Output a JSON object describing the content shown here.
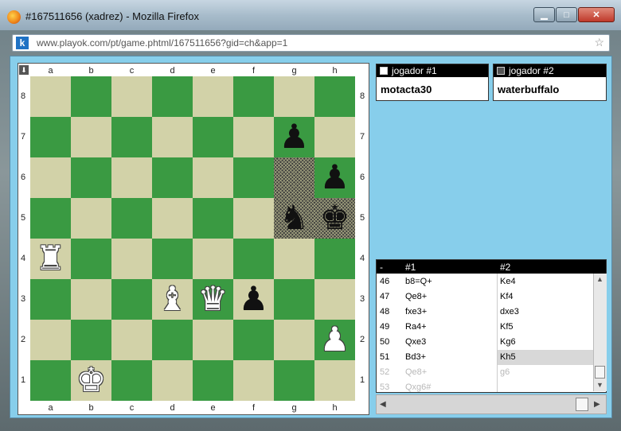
{
  "window": {
    "title": "#167511656 (xadrez) - Mozilla Firefox",
    "min": "▁",
    "max": "□",
    "close": "✕"
  },
  "browser": {
    "site_icon_letter": "k",
    "url": "www.playok.com/pt/game.phtml/167511656?gid=ch&app=1",
    "icons": [
      "firefox-icon",
      "site-icon",
      "star-icon"
    ]
  },
  "board": {
    "corner_btn": "⬇",
    "files": [
      "a",
      "b",
      "c",
      "d",
      "e",
      "f",
      "g",
      "h"
    ],
    "ranks": [
      "8",
      "7",
      "6",
      "5",
      "4",
      "3",
      "2",
      "1"
    ],
    "light_color": "#d2d2a8",
    "dark_color": "#3a9a42",
    "highlight_squares": [
      "g6",
      "g5",
      "h5"
    ],
    "pieces": [
      {
        "square": "g7",
        "color": "black",
        "glyph": "♟",
        "name": "black-pawn"
      },
      {
        "square": "h6",
        "color": "black",
        "glyph": "♟",
        "name": "black-pawn"
      },
      {
        "square": "g5",
        "color": "black",
        "glyph": "♞",
        "name": "black-knight"
      },
      {
        "square": "h5",
        "color": "black",
        "glyph": "♚",
        "name": "black-king"
      },
      {
        "square": "a4",
        "color": "white",
        "glyph": "♜",
        "name": "white-rook"
      },
      {
        "square": "d3",
        "color": "white",
        "glyph": "♝",
        "name": "white-bishop"
      },
      {
        "square": "e3",
        "color": "white",
        "glyph": "♛",
        "name": "white-queen"
      },
      {
        "square": "f3",
        "color": "black",
        "glyph": "♟",
        "name": "black-pawn"
      },
      {
        "square": "h2",
        "color": "white",
        "glyph": "♟",
        "name": "white-pawn"
      },
      {
        "square": "b1",
        "color": "white",
        "glyph": "♚",
        "name": "white-king"
      }
    ]
  },
  "players": [
    {
      "label": "jogador #1",
      "name": "motacta30",
      "swatch": "#ffffff"
    },
    {
      "label": "jogador #2",
      "name": "waterbuffalo",
      "swatch": "#555555"
    }
  ],
  "moves": {
    "headers": [
      "-",
      "#1",
      "#2"
    ],
    "rows": [
      {
        "n": "46",
        "w": "b8=Q+",
        "b": "Ke4"
      },
      {
        "n": "47",
        "w": "Qe8+",
        "b": "Kf4"
      },
      {
        "n": "48",
        "w": "fxe3+",
        "b": "dxe3"
      },
      {
        "n": "49",
        "w": "Ra4+",
        "b": "Kf5"
      },
      {
        "n": "50",
        "w": "Qxe3",
        "b": "Kg6"
      },
      {
        "n": "51",
        "w": "Bd3+",
        "b": "Kh5",
        "highlight": true
      },
      {
        "n": "52",
        "w": "Qe8+",
        "b": "g6",
        "grey": true
      },
      {
        "n": "53",
        "w": "Qxg6#",
        "b": "",
        "grey": true
      }
    ]
  },
  "scroll": {
    "up": "▲",
    "down": "▼",
    "left": "◀",
    "right": "▶"
  }
}
